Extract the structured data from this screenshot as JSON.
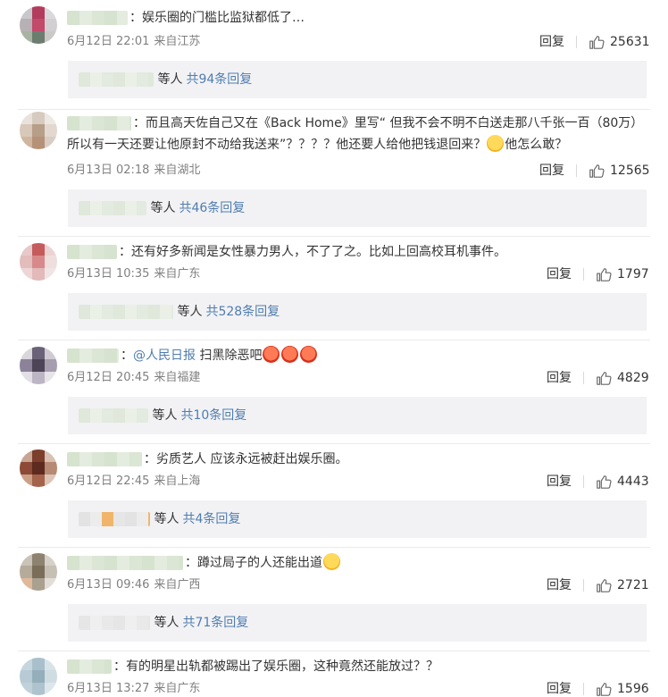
{
  "comments": [
    {
      "text": "：娱乐圈的门槛比监狱都低了…",
      "date": "6月12日 22:01",
      "location": "来自江苏",
      "reply_label": "回复",
      "likes": "25631",
      "sub": {
        "who": "等人",
        "more": "共94条回复"
      }
    },
    {
      "text": "：而且高天佐自己又在《Back Home》里写“ 但我不会不明不白送走那八千张一百（80万）所以有一天还要让他原封不动给我送来”？？？？他还要人给他把钱退回来？",
      "text_tail": "他怎么敢？",
      "date": "6月13日 02:18",
      "location": "来自湖北",
      "reply_label": "回复",
      "likes": "12565",
      "sub": {
        "who": "等人",
        "more": "共46条回复"
      }
    },
    {
      "text": "：还有好多新闻是女性暴力男人，不了了之。比如上回高校耳机事件。",
      "date": "6月13日 10:35",
      "location": "来自广东",
      "reply_label": "回复",
      "likes": "1797",
      "sub": {
        "who": "等人",
        "more": "共528条回复"
      }
    },
    {
      "prefix": "：",
      "mention": "@人民日报",
      "text": " 扫黑除恶吧",
      "date": "6月12日 20:45",
      "location": "来自福建",
      "reply_label": "回复",
      "likes": "4829",
      "sub": {
        "who": "等人",
        "more": "共10条回复"
      }
    },
    {
      "text": "：劣质艺人 应该永远被赶出娱乐圈。",
      "date": "6月12日 22:45",
      "location": "来自上海",
      "reply_label": "回复",
      "likes": "4443",
      "sub": {
        "who": "等人",
        "more": "共4条回复"
      }
    },
    {
      "text": "：蹲过局子的人还能出道",
      "date": "6月13日 09:46",
      "location": "来自广西",
      "reply_label": "回复",
      "likes": "2721",
      "sub": {
        "who": "等人",
        "more": "共71条回复"
      }
    },
    {
      "text": "：有的明星出轨都被踢出了娱乐圈，这种竟然还能放过？？",
      "date": "6月13日 13:27",
      "location": "来自广东",
      "reply_label": "回复",
      "likes": "1596"
    }
  ],
  "colors": {
    "link": "#507daf",
    "meta": "#808080",
    "subbox": "#f2f2f5"
  },
  "icons": {
    "like": "thumbs-up-icon",
    "emoji_angry": "angry-face-icon",
    "emoji_sweat": "sweat-face-icon",
    "emoji_grin": "grin-face-icon"
  }
}
